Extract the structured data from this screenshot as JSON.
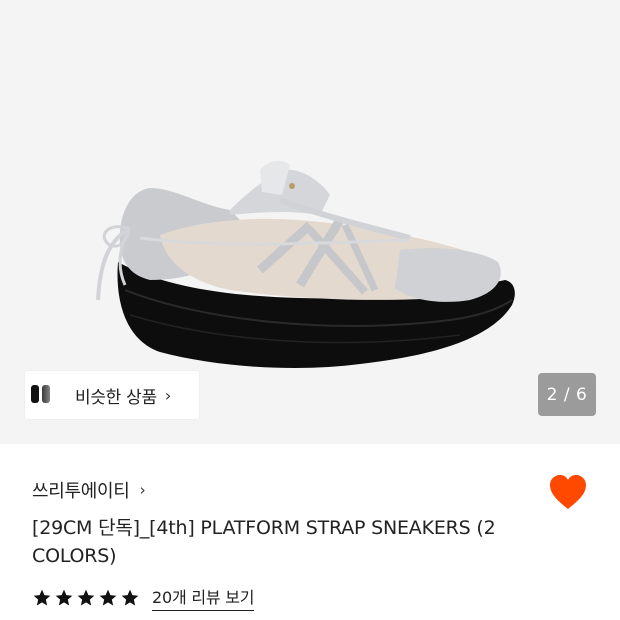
{
  "similar_products": {
    "label": "비슷한 상품"
  },
  "pager": {
    "text": "2 / 6"
  },
  "product": {
    "brand": "쓰리투에이티",
    "title": "[29CM 단독]_[4th] PLATFORM STRAP SNEAKERS (2 COLORS)",
    "rating": 5,
    "review_link": "20개 리뷰 보기",
    "liked": true
  },
  "icons": {
    "similar_chevron": "chevron-right-icon",
    "brand_chevron": "chevron-right-icon",
    "heart": "heart-icon",
    "star": "star-icon"
  },
  "colors": {
    "heart": "#ff4800",
    "pager_bg": "#787878"
  }
}
